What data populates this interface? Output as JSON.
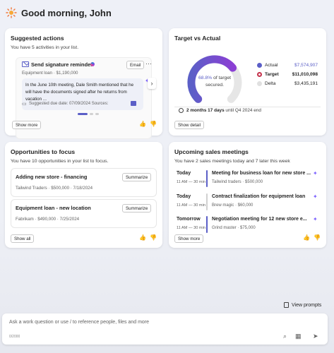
{
  "header": {
    "greeting": "Good morning, John"
  },
  "suggested": {
    "title": "Suggested actions",
    "subtitle": "You have 5 activities in your list.",
    "action": {
      "title": "Send signature reminder",
      "email_label": "Email",
      "more_label": "···",
      "meta": "Equipment loan  ·  $1,190,000",
      "quote": "In the June 10th meeting, Dale Smith mentioned that he will have the documents signed after he returns from vacation ...",
      "due": "Suggested due date: 07/09/2024    Sources:"
    },
    "show_more": "Show more"
  },
  "target": {
    "title": "Target vs Actual",
    "percent": "68.8%",
    "percent_suffix": " of target",
    "secured": "secured.",
    "progress_fraction": 0.688,
    "legend": [
      {
        "name": "Actual",
        "value": "$7,574,907",
        "color": "#5b5fc7"
      },
      {
        "name": "Target",
        "value": "$11,010,098",
        "color": "#c4314b"
      },
      {
        "name": "Delta",
        "value": "$3,435,191",
        "color": "#e0e0e0"
      }
    ],
    "remaining_bold": "2 months 17 days",
    "remaining_rest": " until Q4 2024 end",
    "show_detail": "Show detail"
  },
  "opportunities": {
    "title": "Opportunities to focus",
    "subtitle": "You have 10 opportunities in your list to focus.",
    "items": [
      {
        "title": "Adding new store - financing",
        "meta": "Tailwind Traders  ·  $500,000  ·  7/18/2024",
        "button": "Summarize"
      },
      {
        "title": "Equipment loan - new location",
        "meta": "Fabrikam  ·  $490,000  ·  7/25/2024",
        "button": "Summarize"
      }
    ],
    "show_all": "Show all"
  },
  "meetings": {
    "title": "Upcoming sales meetings",
    "subtitle": "You have 2 sales meetings today and 7 later this week",
    "items": [
      {
        "day": "Today",
        "time": "11 AM — 30 min",
        "title": "Meeting for business loan for new store ...",
        "meta": "Tailwind traders  ·  $500,000",
        "bar_color": "#5b5fc7"
      },
      {
        "day": "Today",
        "time": "11 AM — 30 min",
        "title": "Contract finalization for equipment loan",
        "meta": "Brew magic  ·  $60,000",
        "bar_color": "#d1d1d1"
      },
      {
        "day": "Tomorrow",
        "time": "11 AM — 30 min",
        "title": "Negotiation meeting for 12 new store e...",
        "meta": "Grind master  ·  $75,000",
        "bar_color": "#5b5fc7"
      }
    ],
    "show_more": "Show more"
  },
  "footer": {
    "view_prompts": "View prompts",
    "composer_placeholder": "Ask a work question or use / to reference people, files and more",
    "counter": "0/2000"
  }
}
